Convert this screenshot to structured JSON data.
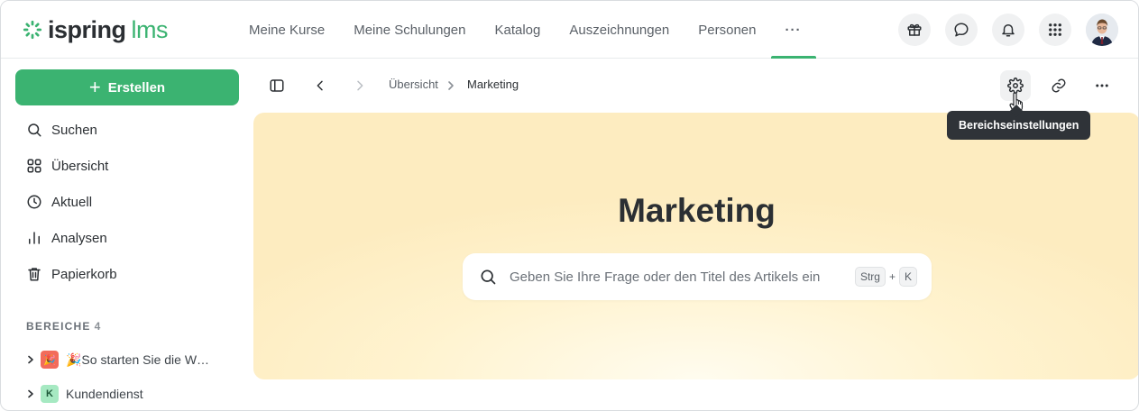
{
  "brand": {
    "name": "ispring",
    "suffix": "lms",
    "color": "#3bb371"
  },
  "nav": {
    "items": [
      "Meine Kurse",
      "Meine Schulungen",
      "Katalog",
      "Auszeichnungen",
      "Personen"
    ],
    "more": "···"
  },
  "top_icons": [
    "gift-icon",
    "chat-icon",
    "bell-icon",
    "apps-grid-icon",
    "avatar"
  ],
  "sidebar": {
    "create_label": "Erstellen",
    "items": [
      {
        "label": "Suchen",
        "icon": "search-icon"
      },
      {
        "label": "Übersicht",
        "icon": "grid-icon"
      },
      {
        "label": "Aktuell",
        "icon": "clock-icon"
      },
      {
        "label": "Analysen",
        "icon": "bar-chart-icon"
      },
      {
        "label": "Papierkorb",
        "icon": "trash-icon"
      }
    ],
    "section": {
      "title": "BEREICHE",
      "count": "4"
    },
    "spaces": [
      {
        "label": "🎉So starten Sie die W…",
        "badge": "🎉",
        "badge_bg": "#f26b5b"
      },
      {
        "label": "Kundendienst",
        "badge": "K",
        "badge_bg": "#a6e9c2"
      }
    ]
  },
  "breadcrumb": {
    "parent": "Übersicht",
    "current": "Marketing"
  },
  "tooltip": "Bereichseinstellungen",
  "hero": {
    "title": "Marketing",
    "search_placeholder": "Geben Sie Ihre Frage oder den Titel des Artikels ein",
    "shortcut": {
      "key1": "Strg",
      "plus": "+",
      "key2": "K"
    }
  }
}
